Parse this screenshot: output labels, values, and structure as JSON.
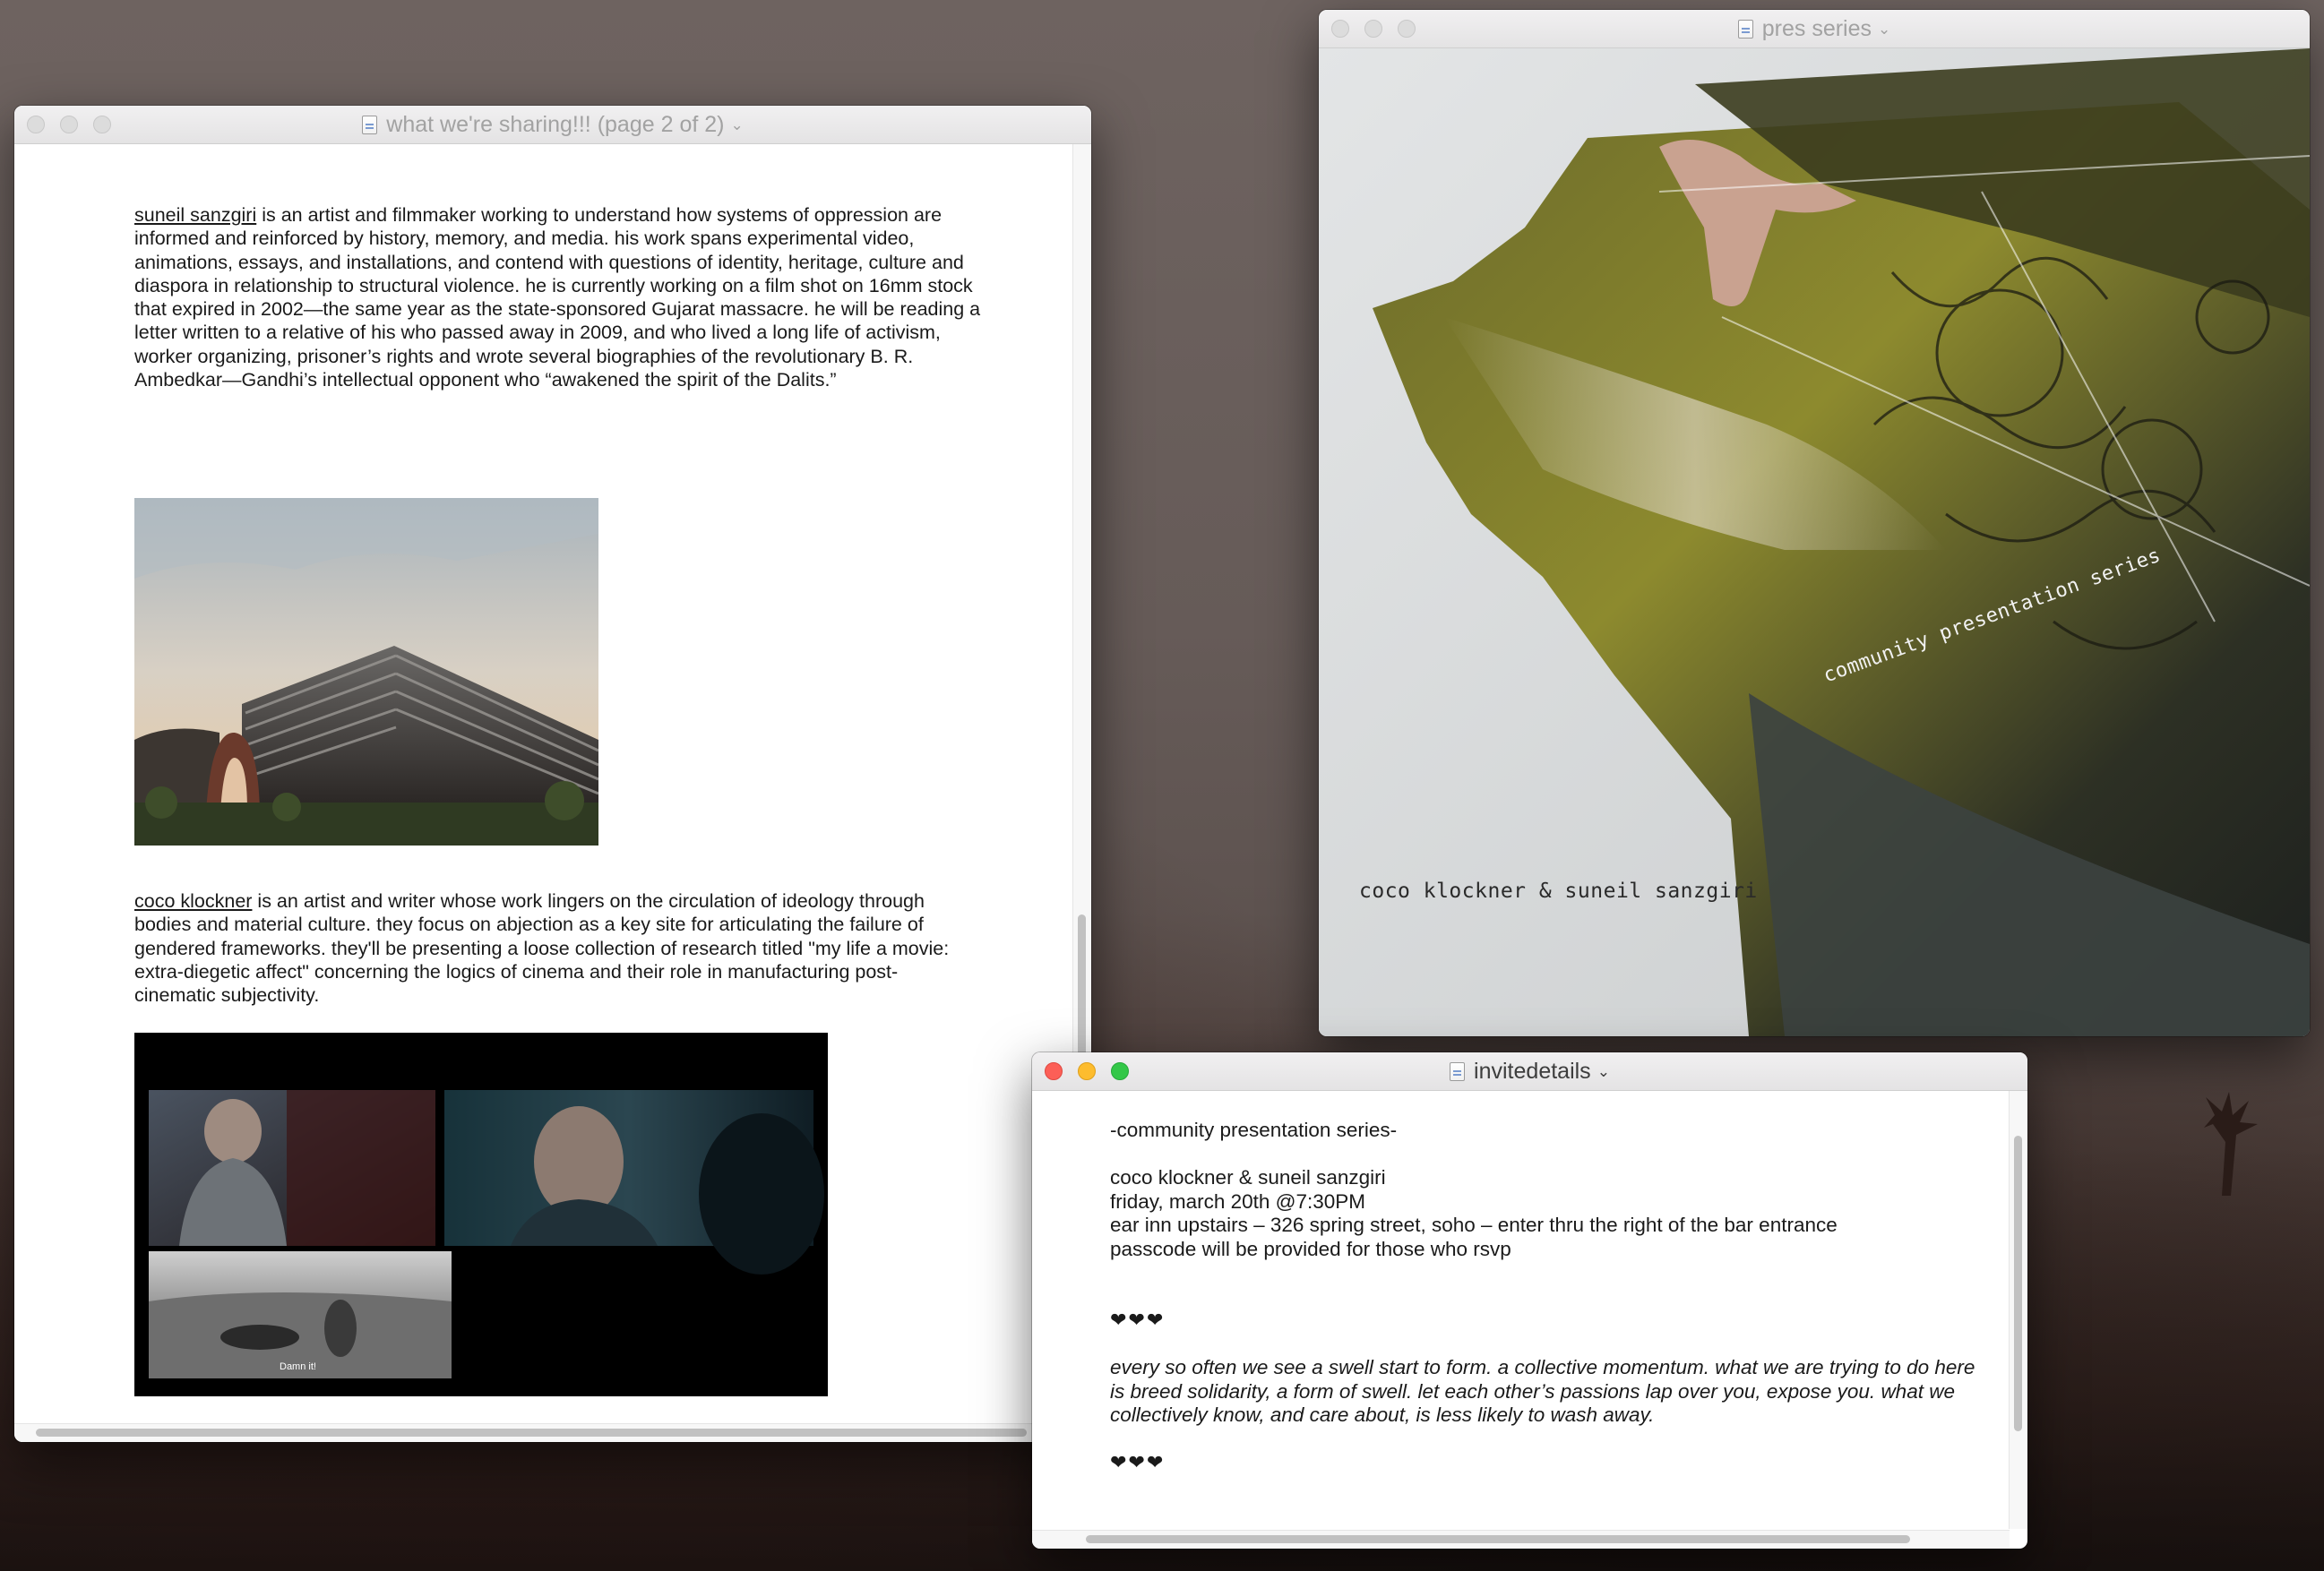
{
  "window_sharing": {
    "title": "what we're sharing!!! (page 2 of 2)",
    "bio1_name": "suneil sanzgiri",
    "bio1_text": " is an artist and filmmaker working to understand how systems of oppression are informed and reinforced by history, memory, and media. his work spans experimental video, animations, essays, and installations, and contend with questions of identity, heritage, culture and diaspora in relationship to structural violence. he is currently working on a film shot on 16mm stock that expired in 2002—the same year as the state-sponsored Gujarat massacre. he will be reading a letter written to a relative of his who passed away in 2009, and who lived a long life of activism, worker organizing, prisoner’s rights and wrote several biographies of the revolutionary B. R. Ambedkar—Gandhi’s intellectual opponent who “awakened the spirit of the Dalits.”",
    "bio2_name": "coco klockner",
    "bio2_text": " is an artist and writer whose work lingers on the circulation of ideology through bodies and material culture. they focus on abjection as a key site for articulating the failure of gendered frameworks. they'll be presenting a loose collection of research titled \"my life a movie: extra-diegetic affect\" concerning the logics of cinema and their role in manufacturing post-cinematic subjectivity.",
    "still_subtitle": "Damn it!"
  },
  "window_pres": {
    "title": "pres series",
    "art_series_text": "community presentation series",
    "art_caption": "coco klockner & suneil sanzgiri"
  },
  "window_invite": {
    "title": "invitedetails",
    "line_heading": "-community presentation series-",
    "line_names": "coco klockner & suneil sanzgiri",
    "line_date": "friday, march 20th @7:30PM",
    "line_venue": "ear inn upstairs – 326 spring street, soho – enter thru the right of the bar entrance",
    "line_passcode": "passcode will be provided for those who rsvp",
    "hearts_1": "❤❤❤",
    "statement": "every so often we see a swell start to form. a collective momentum. what we are trying to do here is breed solidarity, a form of swell. let each other’s passions lap over you, expose you. what we collectively know, and care about, is less likely to wash away.",
    "hearts_2": "❤❤❤"
  }
}
